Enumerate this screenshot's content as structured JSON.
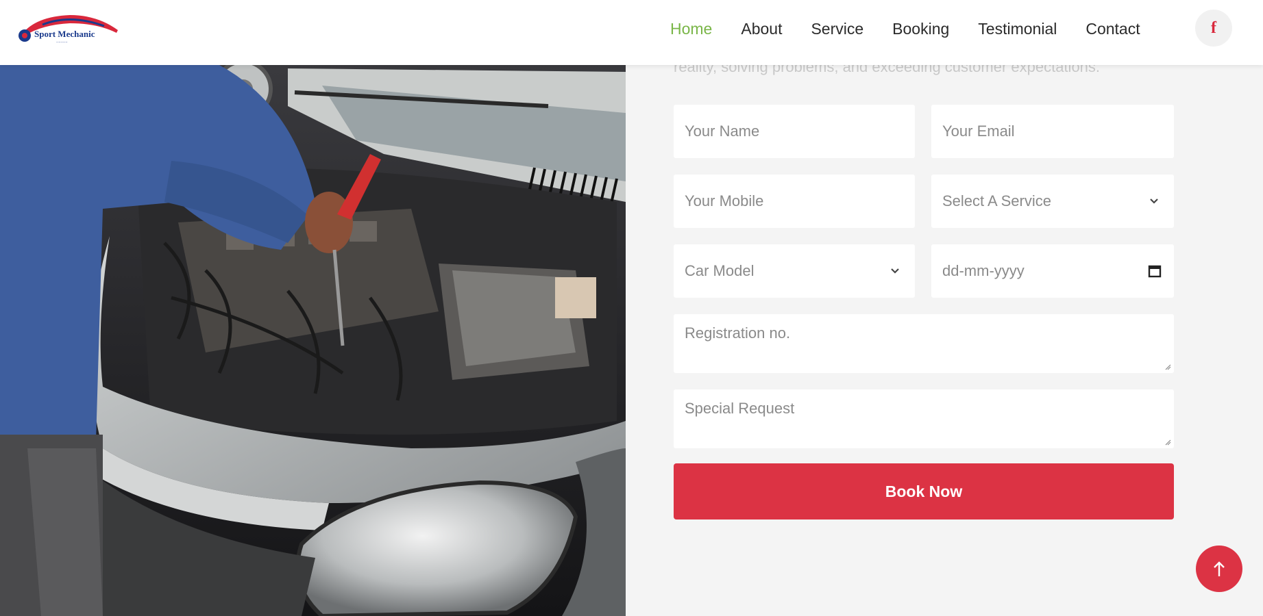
{
  "brand": {
    "name": "Sport Mechanic",
    "tagline": "..........",
    "colors": {
      "primary": "#dc3344",
      "nav_active": "#7ab648",
      "logo_blue": "#1a3a8c"
    }
  },
  "nav": {
    "items": [
      {
        "label": "Home",
        "active": true
      },
      {
        "label": "About",
        "active": false
      },
      {
        "label": "Service",
        "active": false
      },
      {
        "label": "Booking",
        "active": false
      },
      {
        "label": "Testimonial",
        "active": false
      },
      {
        "label": "Contact",
        "active": false
      }
    ],
    "social_icon": "facebook-icon",
    "social_glyph": "f"
  },
  "hero": {
    "image_icon": "car-engine-repair-photo"
  },
  "form": {
    "intro_cut": "reality, solving problems, and exceeding customer expectations.",
    "name_placeholder": "Your Name",
    "email_placeholder": "Your Email",
    "mobile_placeholder": "Your Mobile",
    "service_selected": "Select A Service",
    "car_model_selected": "Car Model",
    "date_placeholder": "dd-mm-yyyy",
    "registration_placeholder": "Registration no.",
    "special_placeholder": "Special Request",
    "submit_label": "Book Now"
  },
  "scroll_top_icon": "arrow-up-icon"
}
